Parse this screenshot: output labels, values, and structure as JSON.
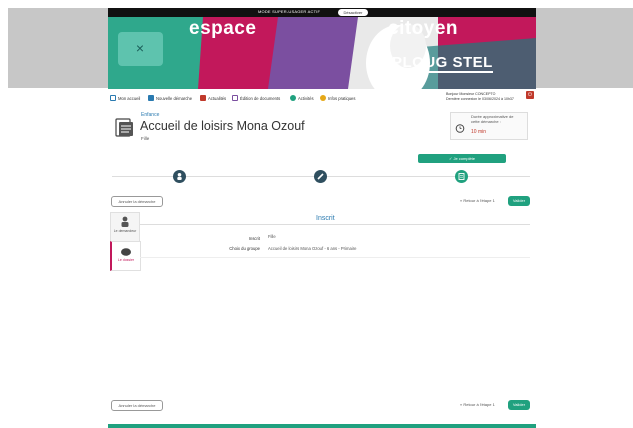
{
  "topbar": {
    "text": "MODE SUPER-USAGER ACTIF",
    "button_label": "Désactiver"
  },
  "banner": {
    "word1": "espace",
    "word2": "citoyen",
    "city": "PLOUG STEL"
  },
  "nav": {
    "items": [
      {
        "label": "Mon accueil",
        "icon": "home-icon",
        "color": "#2a7ab0"
      },
      {
        "label": "Nouvelle démarche",
        "icon": "plus-icon",
        "color": "#2a7ab0"
      },
      {
        "label": "Actualités",
        "icon": "news-icon",
        "color": "#c0392b"
      },
      {
        "label": "Édition de documents",
        "icon": "document-icon",
        "color": "#7b4fa0"
      },
      {
        "label": "Activités",
        "icon": "activity-icon",
        "color": "#20a17f"
      },
      {
        "label": "Infos pratiques",
        "icon": "info-icon",
        "color": "#e6a817"
      }
    ]
  },
  "user": {
    "name": "Bonjour Monsieur CONCEPTO",
    "last_login": "Dernière connexion le 03/06/2024 à 10h37"
  },
  "page": {
    "breadcrumb": "Enfance",
    "title": "Accueil de loisirs Mona Ozouf",
    "subtitle": "Fille"
  },
  "time_box": {
    "label": "Durée approximative de cette démarche :",
    "value": "10 min"
  },
  "complete_label": "✓ Je complète",
  "actions": {
    "abandon_label": "Annuler la démarche",
    "back_label": "« Retour à l'étape 1",
    "validate_label": "Valider"
  },
  "side_tabs": [
    {
      "label": "Le demandeur"
    },
    {
      "label": "Le dossier"
    }
  ],
  "content": {
    "title": "Inscrit",
    "fields": [
      {
        "label": "Inscrit",
        "value": "Fille"
      },
      {
        "label": "Choix du groupe",
        "value": "Accueil de loisirs Mona Ozouf - 6 ans - Primaire"
      }
    ]
  },
  "colors": {
    "accent": "#20a17f",
    "dark": "#2f4f5f",
    "alert": "#c0392b"
  }
}
